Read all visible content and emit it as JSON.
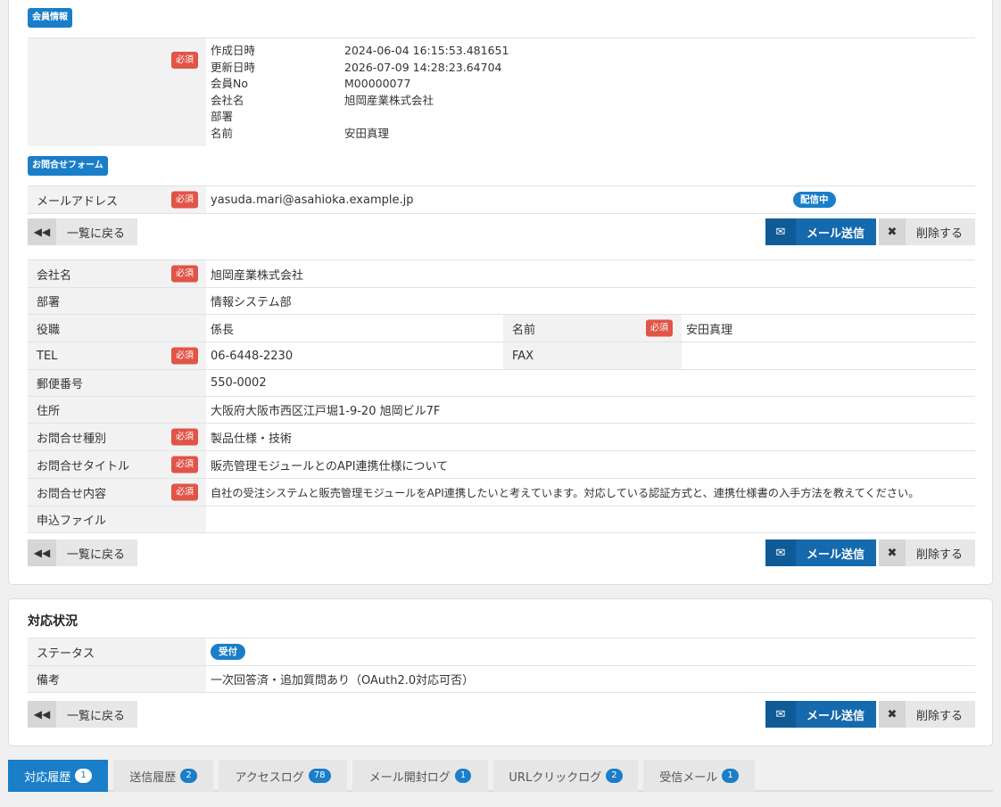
{
  "section_member": {
    "label": "会員情報",
    "required": "必須",
    "fields": [
      {
        "label": "作成日時",
        "value": "2024-06-04 16:15:53.481651"
      },
      {
        "label": "更新日時",
        "value": "2026-07-09 14:28:23.64704"
      },
      {
        "label": "会員No",
        "value": "M00000077"
      },
      {
        "label": "会社名",
        "value": "旭岡産業株式会社"
      },
      {
        "label": "部署",
        "value": ""
      },
      {
        "label": "名前",
        "value": "安田真理"
      }
    ]
  },
  "section_form": {
    "label": "お問合せフォーム",
    "email_label": "メールアドレス",
    "email_value": "yasuda.mari@asahioka.example.jp",
    "email_status": "配信中"
  },
  "buttons": {
    "back": "一覧に戻る",
    "mail": "メール送信",
    "delete": "削除する"
  },
  "inquiry": {
    "required": "必須",
    "company_label": "会社名",
    "company_value": "旭岡産業株式会社",
    "dept_label": "部署",
    "dept_value": "情報システム部",
    "position_label": "役職",
    "position_value": "係長",
    "name_label": "名前",
    "name_value": "安田真理",
    "tel_label": "TEL",
    "tel_value": "06-6448-2230",
    "fax_label": "FAX",
    "fax_value": "",
    "zip_label": "郵便番号",
    "zip_value": "550-0002",
    "address_label": "住所",
    "address_value": "大阪府大阪市西区江戸堀1-9-20 旭岡ビル7F",
    "type_label": "お問合せ種別",
    "type_value": "製品仕様・技術",
    "title_label": "お問合せタイトル",
    "title_value": "販売管理モジュールとのAPI連携仕様について",
    "content_label": "お問合せ内容",
    "content_value": "自社の受注システムと販売管理モジュールをAPI連携したいと考えています。対応している認証方式と、連携仕様書の入手方法を教えてください。",
    "file_label": "申込ファイル",
    "file_value": ""
  },
  "status_section": {
    "title": "対応状況",
    "status_label": "ステータス",
    "status_value": "受付",
    "note_label": "備考",
    "note_value": "一次回答済・追加質問あり（OAuth2.0対応可否）"
  },
  "tabs": [
    {
      "label": "対応履歴",
      "count": "1"
    },
    {
      "label": "送信履歴",
      "count": "2"
    },
    {
      "label": "アクセスログ",
      "count": "78"
    },
    {
      "label": "メール開封ログ",
      "count": "1"
    },
    {
      "label": "URLクリックログ",
      "count": "2"
    },
    {
      "label": "受信メール",
      "count": "1"
    }
  ],
  "colors": {
    "accent": "#1a7ec8",
    "required": "#e05548",
    "mail_button": "#1569ad"
  }
}
